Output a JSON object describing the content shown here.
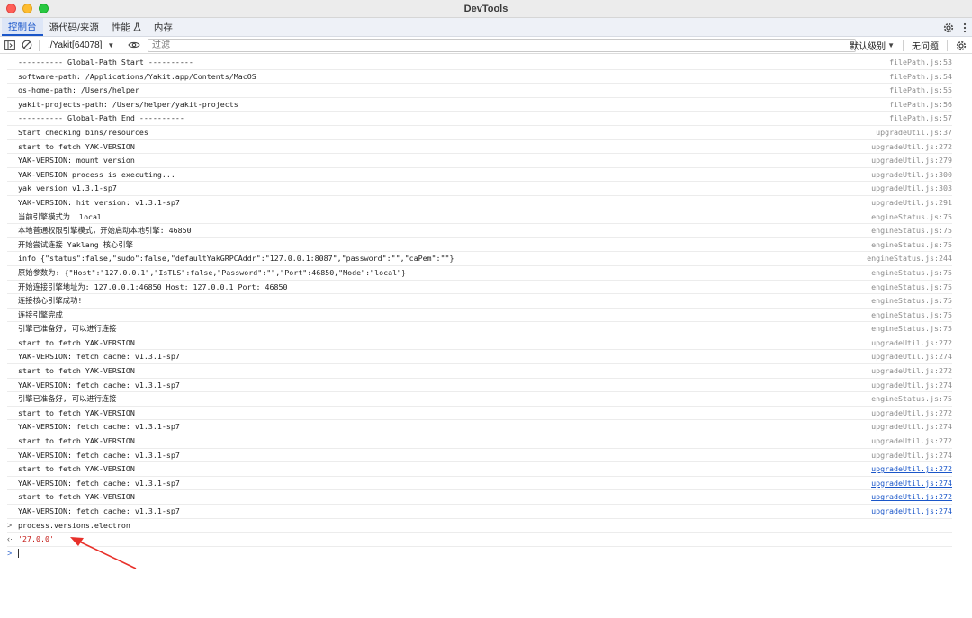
{
  "window": {
    "title": "DevTools"
  },
  "tabs": [
    {
      "label": "控制台",
      "active": true
    },
    {
      "label": "源代码/来源",
      "active": false
    },
    {
      "label": "性能",
      "active": false
    },
    {
      "label": "内存",
      "active": false
    }
  ],
  "toolbar": {
    "context": "./Yakit[64078]",
    "filter_placeholder": "过滤",
    "levels": "默认级别",
    "issues": "无问题"
  },
  "logs": [
    {
      "text": "---------- Global-Path Start ----------",
      "source": "filePath.js:53",
      "link": false
    },
    {
      "text": "software-path: /Applications/Yakit.app/Contents/MacOS",
      "source": "filePath.js:54",
      "link": false
    },
    {
      "text": "os-home-path: /Users/helper",
      "source": "filePath.js:55",
      "link": false
    },
    {
      "text": "yakit-projects-path: /Users/helper/yakit-projects",
      "source": "filePath.js:56",
      "link": false
    },
    {
      "text": "---------- Global-Path End ----------",
      "source": "filePath.js:57",
      "link": false
    },
    {
      "text": "Start checking bins/resources",
      "source": "upgradeUtil.js:37",
      "link": false
    },
    {
      "text": "start to fetch YAK-VERSION",
      "source": "upgradeUtil.js:272",
      "link": false
    },
    {
      "text": "YAK-VERSION: mount version",
      "source": "upgradeUtil.js:279",
      "link": false
    },
    {
      "text": "YAK-VERSION process is executing...",
      "source": "upgradeUtil.js:300",
      "link": false
    },
    {
      "text": "yak version v1.3.1-sp7",
      "source": "upgradeUtil.js:303",
      "link": false
    },
    {
      "text": "YAK-VERSION: hit version: v1.3.1-sp7",
      "source": "upgradeUtil.js:291",
      "link": false
    },
    {
      "text": "当前引擎模式为  local",
      "source": "engineStatus.js:75",
      "link": false
    },
    {
      "text": "本地普通权限引擎模式，开始启动本地引擎: 46850",
      "source": "engineStatus.js:75",
      "link": false
    },
    {
      "text": "开始尝试连接 Yaklang 核心引擎",
      "source": "engineStatus.js:75",
      "link": false
    },
    {
      "text": "info {\"status\":false,\"sudo\":false,\"defaultYakGRPCAddr\":\"127.0.0.1:8087\",\"password\":\"\",\"caPem\":\"\"}",
      "source": "engineStatus.js:244",
      "link": false
    },
    {
      "text": "原始参数为: {\"Host\":\"127.0.0.1\",\"IsTLS\":false,\"Password\":\"\",\"Port\":46850,\"Mode\":\"local\"}",
      "source": "engineStatus.js:75",
      "link": false
    },
    {
      "text": "开始连接引擎地址为: 127.0.0.1:46850 Host: 127.0.0.1 Port: 46850",
      "source": "engineStatus.js:75",
      "link": false
    },
    {
      "text": "连接核心引擎成功!",
      "source": "engineStatus.js:75",
      "link": false
    },
    {
      "text": "连接引擎完成",
      "source": "engineStatus.js:75",
      "link": false
    },
    {
      "text": "引擎已准备好, 可以进行连接",
      "source": "engineStatus.js:75",
      "link": false
    },
    {
      "text": "start to fetch YAK-VERSION",
      "source": "upgradeUtil.js:272",
      "link": false
    },
    {
      "text": "YAK-VERSION: fetch cache: v1.3.1-sp7",
      "source": "upgradeUtil.js:274",
      "link": false
    },
    {
      "text": "start to fetch YAK-VERSION",
      "source": "upgradeUtil.js:272",
      "link": false
    },
    {
      "text": "YAK-VERSION: fetch cache: v1.3.1-sp7",
      "source": "upgradeUtil.js:274",
      "link": false
    },
    {
      "text": "引擎已准备好, 可以进行连接",
      "source": "engineStatus.js:75",
      "link": false
    },
    {
      "text": "start to fetch YAK-VERSION",
      "source": "upgradeUtil.js:272",
      "link": false
    },
    {
      "text": "YAK-VERSION: fetch cache: v1.3.1-sp7",
      "source": "upgradeUtil.js:274",
      "link": false
    },
    {
      "text": "start to fetch YAK-VERSION",
      "source": "upgradeUtil.js:272",
      "link": false
    },
    {
      "text": "YAK-VERSION: fetch cache: v1.3.1-sp7",
      "source": "upgradeUtil.js:274",
      "link": false
    },
    {
      "text": "start to fetch YAK-VERSION",
      "source": "upgradeUtil.js:272",
      "link": true
    },
    {
      "text": "YAK-VERSION: fetch cache: v1.3.1-sp7",
      "source": "upgradeUtil.js:274",
      "link": true
    },
    {
      "text": "start to fetch YAK-VERSION",
      "source": "upgradeUtil.js:272",
      "link": true
    },
    {
      "text": "YAK-VERSION: fetch cache: v1.3.1-sp7",
      "source": "upgradeUtil.js:274",
      "link": true
    }
  ],
  "command": {
    "input": "process.versions.electron",
    "result": "'27.0.0'"
  },
  "colors": {
    "accent": "#1a56c9",
    "result_red": "#c41a16",
    "annotation_arrow": "#e8302a"
  }
}
